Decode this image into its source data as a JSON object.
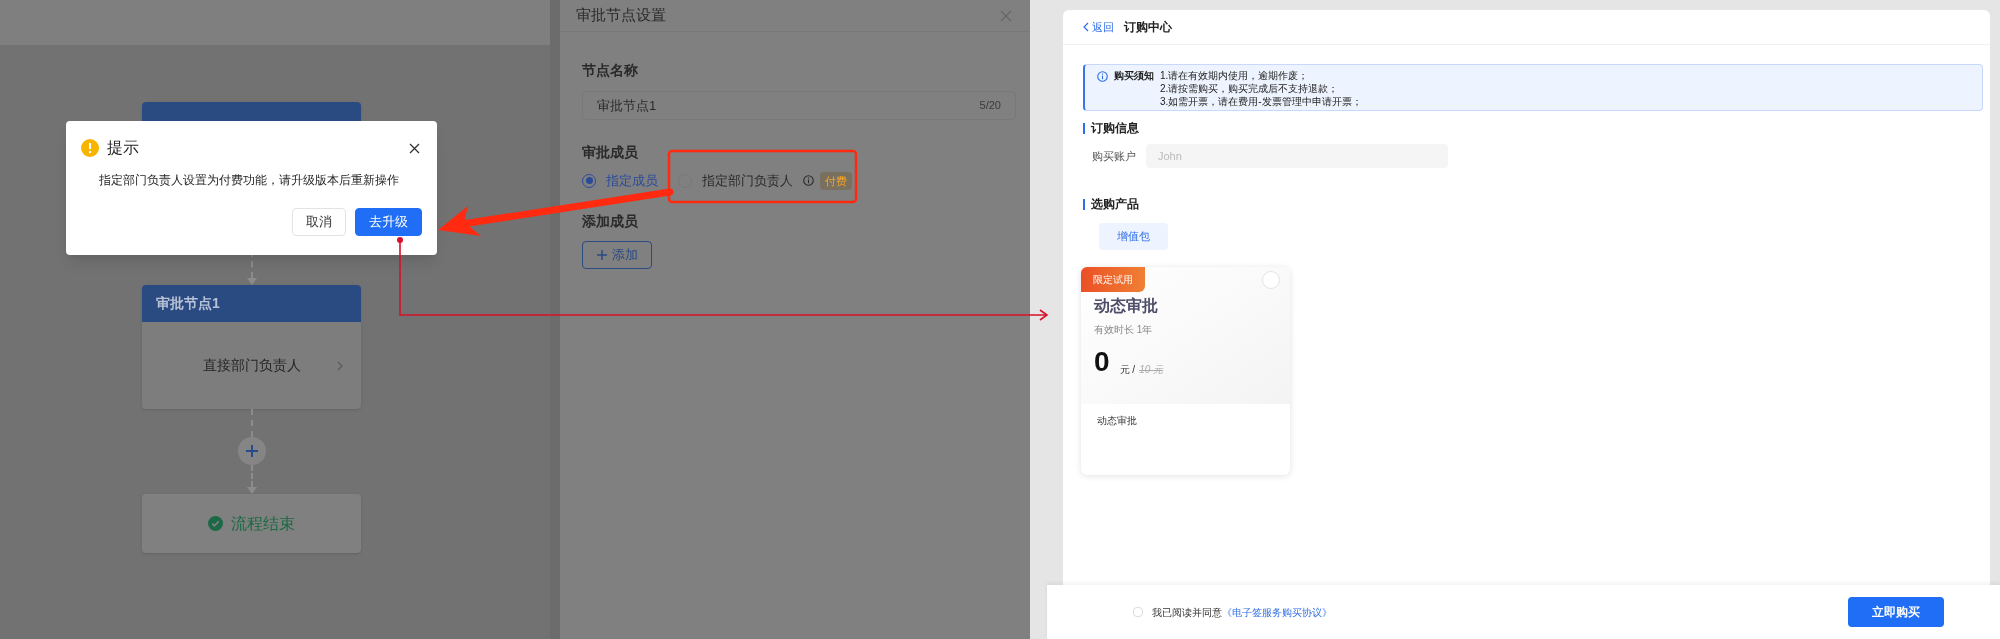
{
  "flow_editor": {
    "nodes": [
      {
        "kind": "applicant"
      },
      {
        "kind": "approver",
        "title": "审批节点1",
        "content": "直接部门负责人"
      },
      {
        "kind": "add"
      },
      {
        "kind": "end",
        "title": "流程结束"
      }
    ]
  },
  "dialog": {
    "title": "提示",
    "message": "指定部门负责人设置为付费功能，请升级版本后重新操作",
    "buttons": [
      {
        "label": "取消",
        "kind": "secondary"
      },
      {
        "label": "去升级",
        "kind": "primary"
      }
    ]
  },
  "drawer": {
    "title": "审批节点设置",
    "name_label": "节点名称",
    "name_value": "审批节点1",
    "name_counter": "5/20",
    "members_label": "审批成员",
    "options": [
      {
        "label": "指定成员",
        "selected": true
      },
      {
        "label": "指定部门负责人",
        "selected": false,
        "tag": "付费"
      }
    ],
    "add_label": "添加成员",
    "add_button": "添加"
  },
  "order_center": {
    "back": "返回",
    "title": "订购中心",
    "notice": {
      "title": "购买须知",
      "lines": [
        "1.请在有效期内使用，逾期作废；",
        "2.请按需购买，购买完成后不支持退款；",
        "3.如需开票，请在费用-发票管理中申请开票；"
      ]
    },
    "order_info_label": "订购信息",
    "account_label": "购买账户",
    "account_placeholder": "John",
    "products_label": "选购产品",
    "product_tabs": [
      {
        "label": "增值包",
        "selected": true
      }
    ],
    "products": [
      {
        "badge": "限定试用",
        "name": "动态审批",
        "duration": "有效时长 1年",
        "price": "0",
        "unit": "元 /",
        "original_price": "10 元",
        "description": "动态审批",
        "selected": false
      }
    ],
    "agreement": {
      "checked": false,
      "text": "我已阅读并同意",
      "link": "《电子签服务购买协议》"
    },
    "buy_button": "立即购买"
  }
}
